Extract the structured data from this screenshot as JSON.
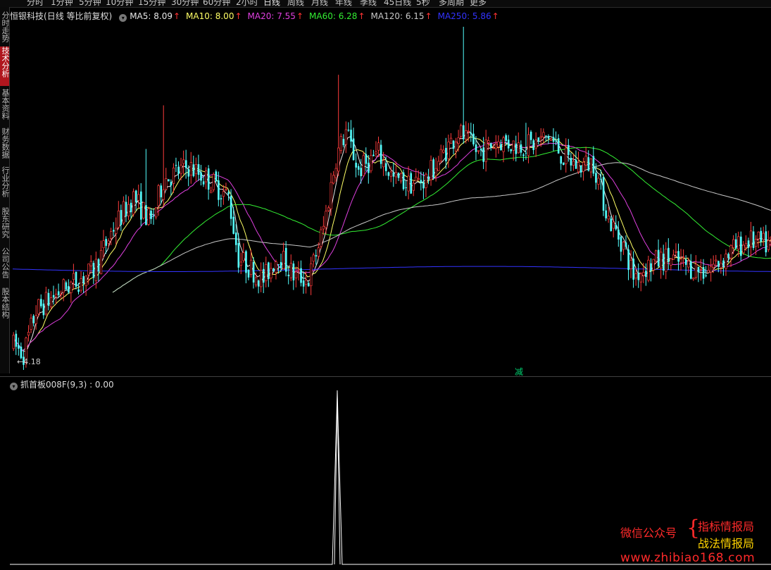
{
  "period_tabs": [
    "分时",
    "1分钟",
    "5分钟",
    "10分钟",
    "15分钟",
    "30分钟",
    "60分钟",
    "2小时",
    "日线",
    "周线",
    "月线",
    "年线",
    "季线",
    "45日线",
    "5秒",
    "多周期",
    "更多"
  ],
  "active_period": "日线",
  "side_tabs": [
    "分时走势",
    "技术分析",
    "基本资料",
    "财务数据",
    "行业分析",
    "股东研究",
    "公司公告",
    "股本结构"
  ],
  "active_side_tab": "技术分析",
  "stock": {
    "name": "恒银科技",
    "mode": "(日线 等比前复权)"
  },
  "ma_legend": [
    {
      "label": "MA5: 8.09",
      "color": "#e8e8e8"
    },
    {
      "label": "MA10: 8.00",
      "color": "#ffff66"
    },
    {
      "label": "MA20: 7.55",
      "color": "#e040e0"
    },
    {
      "label": "MA60: 6.28",
      "color": "#33ee33"
    },
    {
      "label": "MA120: 6.15",
      "color": "#c8c8c8"
    },
    {
      "label": "MA250: 5.86",
      "color": "#3333ff"
    }
  ],
  "up_arrow": "↑",
  "min_price_label": "←4.18",
  "signal_label": "减",
  "indicator": {
    "title": "抓首板008F(9,3) : 0.00",
    "icon": "chevron-down-icon"
  },
  "watermark": {
    "left": "微信公众号",
    "brace": "{",
    "right_top": "指标情报局",
    "right_bottom": "战法情报局",
    "url": "www.zhibiao168.com"
  },
  "colors": {
    "up_candle": "#ff3c3c",
    "down_candle": "#54ffff",
    "ma5": "#e8e8e8",
    "ma10": "#ffff66",
    "ma20": "#e040e0",
    "ma60": "#33ee33",
    "ma120": "#c8c8c8",
    "ma250": "#3333ff"
  },
  "chart_data": {
    "type": "candlestick",
    "price_low": 4.18,
    "price_high": 11.8,
    "indicator": {
      "name": "抓首板008F(9,3)",
      "current": 0.0,
      "peak": 1.0
    }
  }
}
